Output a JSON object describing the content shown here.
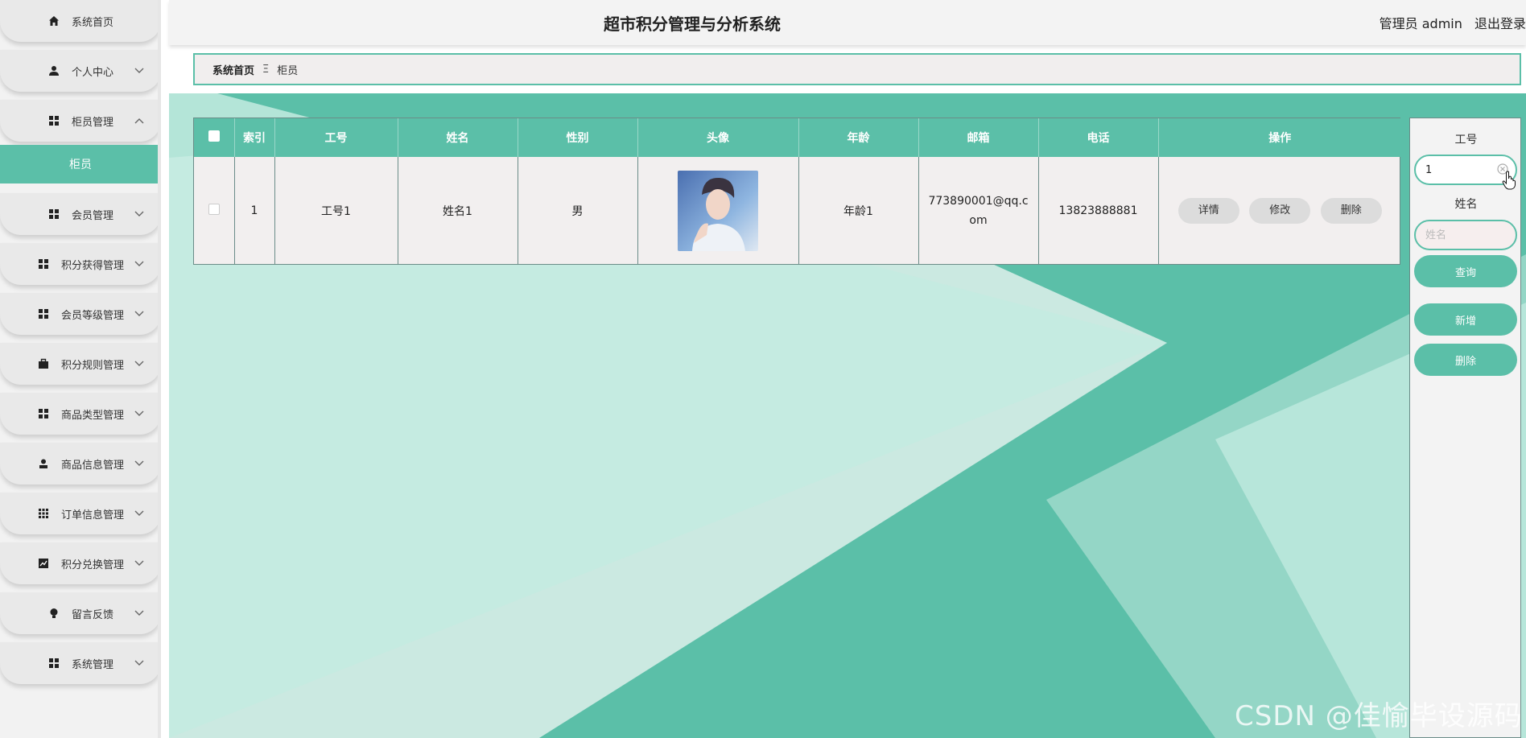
{
  "header": {
    "title": "超市积分管理与分析系统",
    "user_label": "管理员 admin",
    "logout_label": "退出登录"
  },
  "sidebar": {
    "items": [
      {
        "label": "系统首页",
        "icon": "home-icon"
      },
      {
        "label": "个人中心",
        "icon": "user-icon"
      },
      {
        "label": "柜员管理",
        "icon": "grid-icon",
        "expanded": true
      },
      {
        "label": "会员管理",
        "icon": "grid-icon"
      },
      {
        "label": "积分获得管理",
        "icon": "grid-icon"
      },
      {
        "label": "会员等级管理",
        "icon": "grid-icon"
      },
      {
        "label": "积分规则管理",
        "icon": "briefcase-icon"
      },
      {
        "label": "商品类型管理",
        "icon": "grid-icon"
      },
      {
        "label": "商品信息管理",
        "icon": "person-icon"
      },
      {
        "label": "订单信息管理",
        "icon": "apps-icon"
      },
      {
        "label": "积分兑换管理",
        "icon": "chart-icon"
      },
      {
        "label": "留言反馈",
        "icon": "bulb-icon"
      },
      {
        "label": "系统管理",
        "icon": "grid-icon"
      }
    ],
    "submenu": {
      "label": "柜员"
    }
  },
  "breadcrumb": {
    "home": "系统首页",
    "separator": "Ξ",
    "current": "柜员"
  },
  "table": {
    "columns": [
      "索引",
      "工号",
      "姓名",
      "性别",
      "头像",
      "年龄",
      "邮箱",
      "电话",
      "操作"
    ],
    "rows": [
      {
        "index": "1",
        "emp_no": "工号1",
        "name": "姓名1",
        "gender": "男",
        "age": "年龄1",
        "email": "773890001@qq.com",
        "phone": "13823888881",
        "actions": [
          "详情",
          "修改",
          "删除"
        ]
      }
    ]
  },
  "search_panel": {
    "emp_no_label": "工号",
    "emp_no_value": "1",
    "name_label": "姓名",
    "name_placeholder": "姓名",
    "query_button": "查询",
    "add_button": "新增",
    "delete_button": "删除"
  },
  "watermark": "CSDN @佳愉毕设源码",
  "colors": {
    "accent": "#5bbfa8",
    "sidebar_bg": "#e9e9e9",
    "header_bg": "#f3f3f3"
  }
}
